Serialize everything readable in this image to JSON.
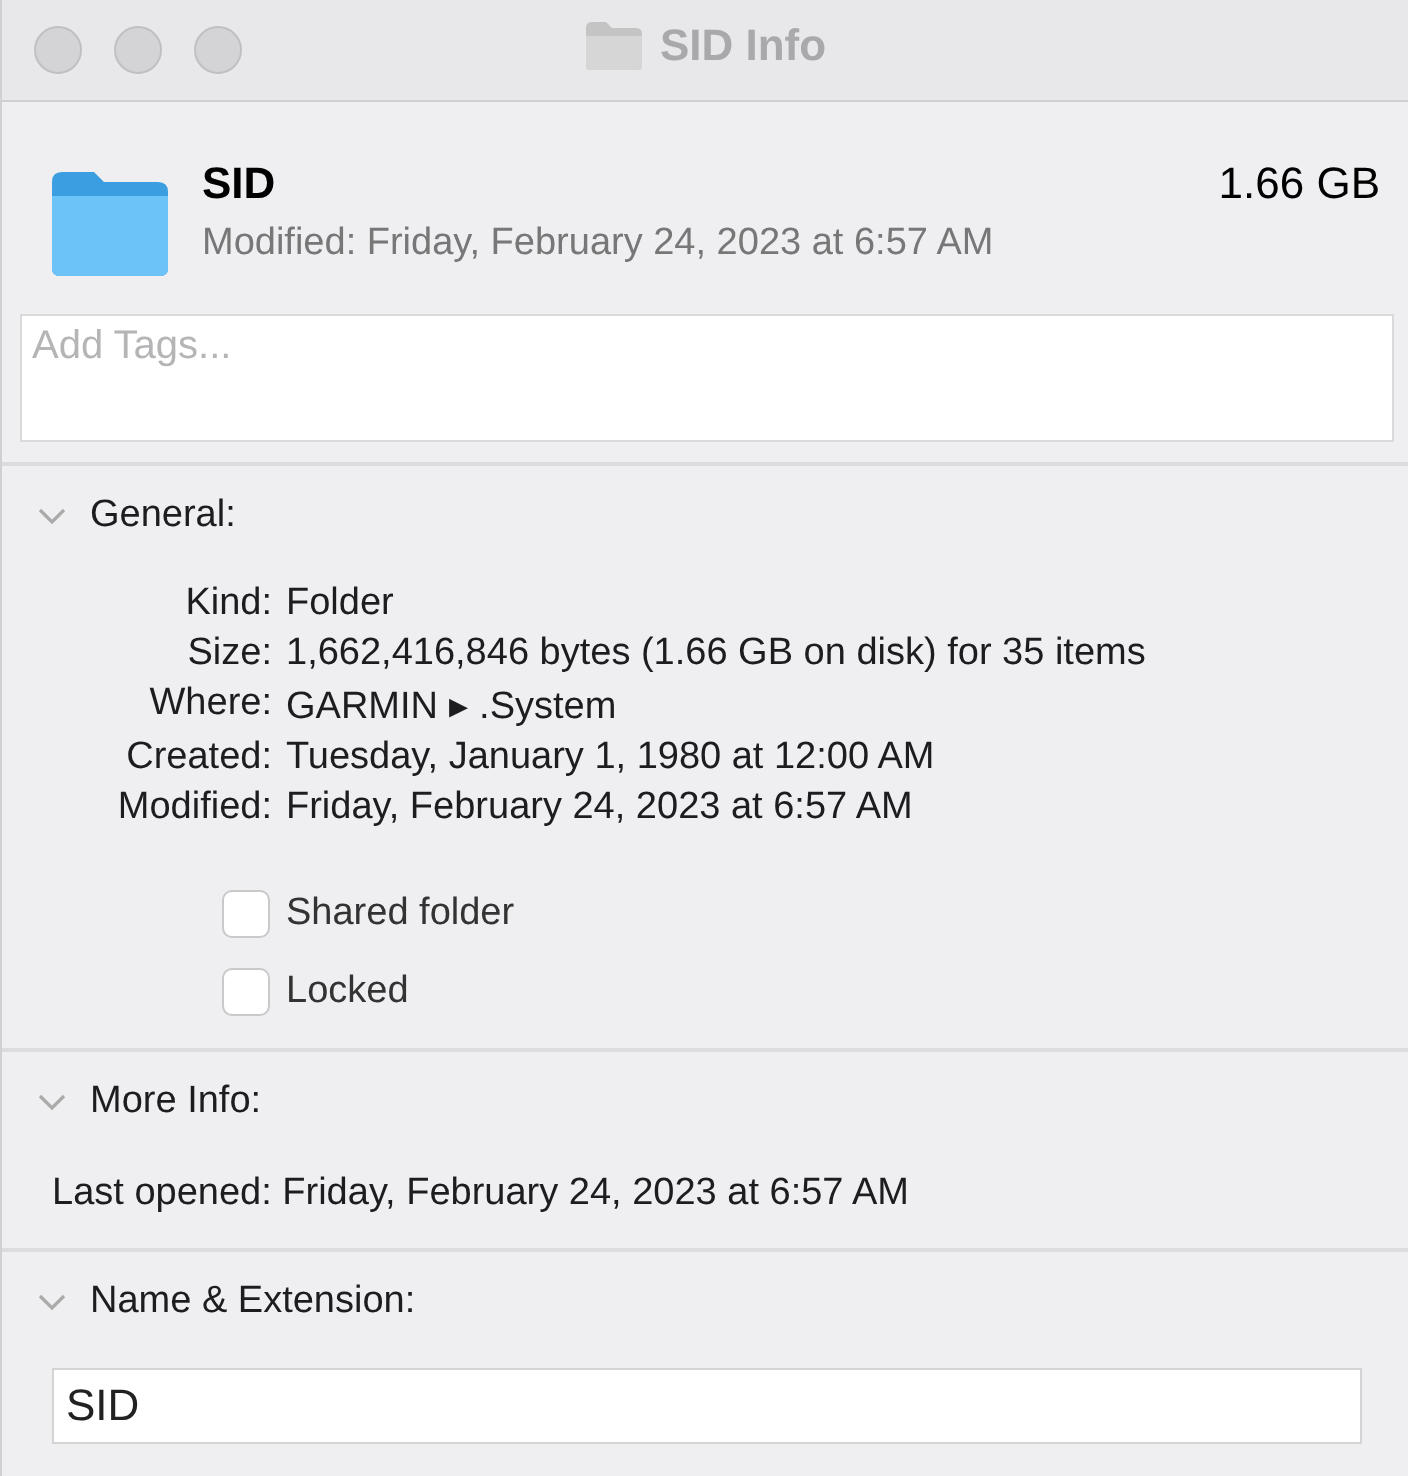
{
  "window": {
    "title": "SID Info"
  },
  "header": {
    "name": "SID",
    "size": "1.66 GB",
    "modified": "Modified: Friday, February 24, 2023 at 6:57 AM"
  },
  "tags": {
    "placeholder": "Add Tags..."
  },
  "general": {
    "title": "General:",
    "expanded": true,
    "fields": [
      {
        "label": "Kind:",
        "value": "Folder"
      },
      {
        "label": "Size:",
        "value": "1,662,416,846 bytes (1.66 GB on disk) for 35 items"
      },
      {
        "label": "Where:",
        "value": "GARMIN ▸ .System"
      },
      {
        "label": "Created:",
        "value": "Tuesday, January 1, 1980 at 12:00 AM"
      },
      {
        "label": "Modified:",
        "value": "Friday, February 24, 2023 at 6:57 AM"
      }
    ],
    "checkboxes": [
      {
        "label": "Shared folder",
        "checked": false
      },
      {
        "label": "Locked",
        "checked": false
      }
    ]
  },
  "more_info": {
    "title": "More Info:",
    "expanded": true,
    "text": "Last opened: Friday, February 24, 2023 at 6:57 AM"
  },
  "name_extension": {
    "title": "Name & Extension:",
    "expanded": true,
    "value": "SID"
  }
}
